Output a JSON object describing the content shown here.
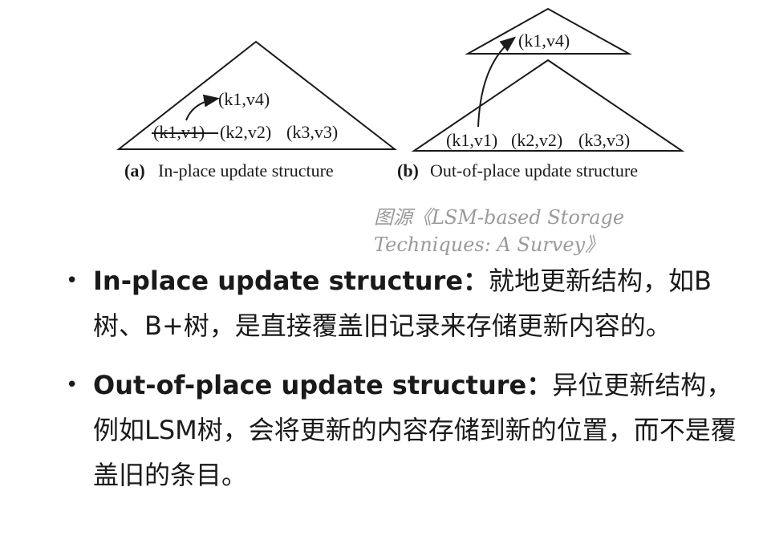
{
  "figure": {
    "left_tree": {
      "update_entry": "(k1,v4)",
      "old_entry": "(k1,v1)",
      "entries": [
        "(k2,v2)",
        "(k3,v3)"
      ],
      "caption_letter": "(a)",
      "caption_text": "In-place update structure"
    },
    "right_tree": {
      "top_entry": "(k1,v4)",
      "entries": [
        "(k1,v1)",
        "(k2,v2)",
        "(k3,v3)"
      ],
      "caption_letter": "(b)",
      "caption_text": "Out-of-place update structure"
    }
  },
  "credit": {
    "line1": "图源《LSM-based Storage",
    "line2": "Techniques: A Survey》"
  },
  "bullets": [
    {
      "term": "In-place update structure：",
      "description": "就地更新结构，如B树、B+树，是直接覆盖旧记录来存储更新内容的。"
    },
    {
      "term": "Out-of-place update structure：",
      "description": "异位更新结构，例如LSM树，会将更新的内容存储到新的位置，而不是覆盖旧的条目。"
    }
  ]
}
